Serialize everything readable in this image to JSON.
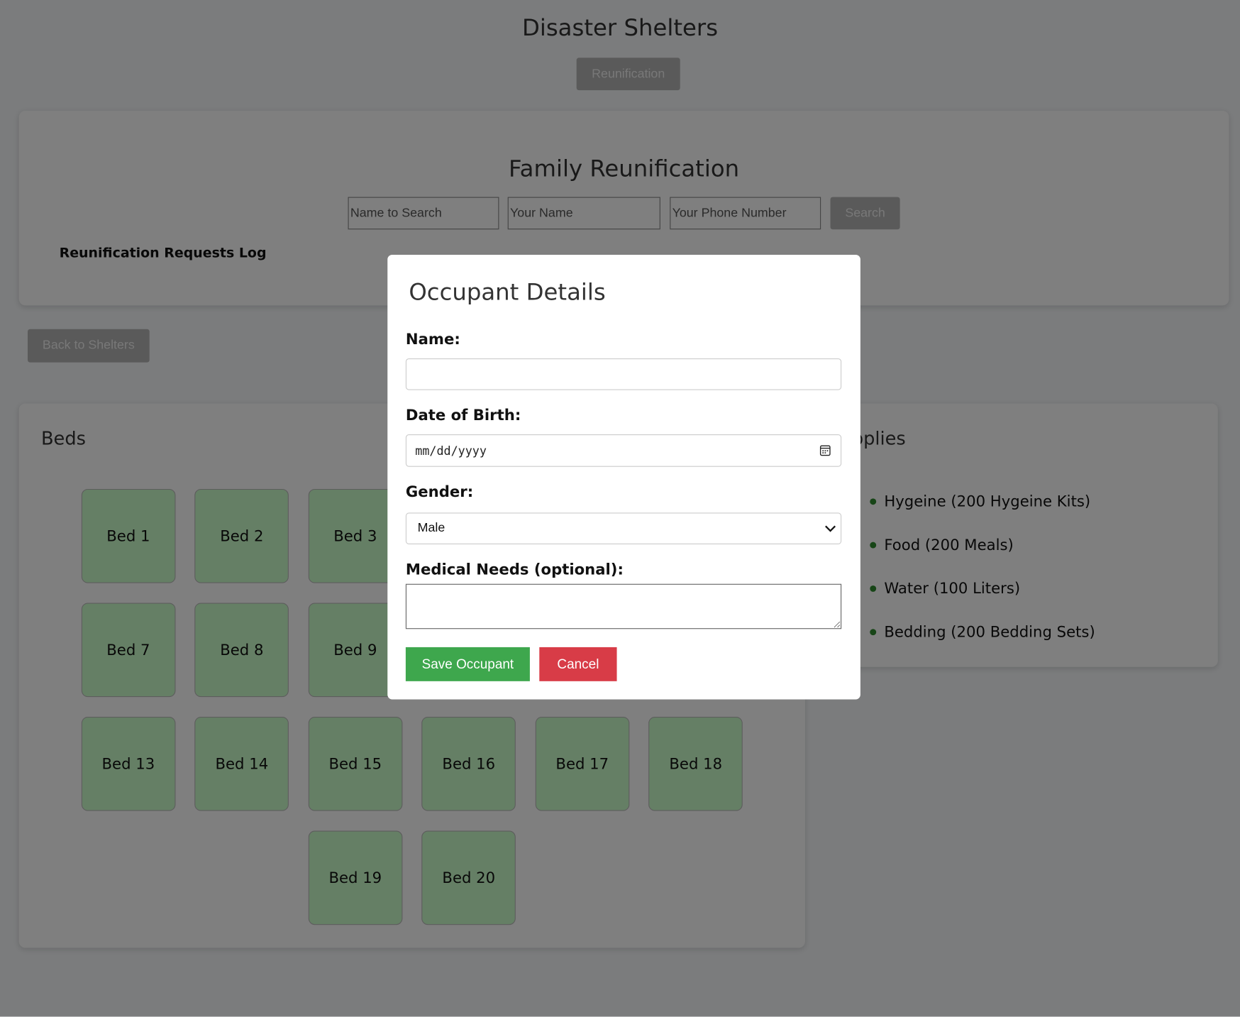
{
  "header": {
    "title": "Disaster Shelters",
    "reunification_button": "Reunification"
  },
  "reunification": {
    "title": "Family Reunification",
    "name_to_search_placeholder": "Name to Search",
    "your_name_placeholder": "Your Name",
    "phone_placeholder": "Your Phone Number",
    "search_button": "Search",
    "log_title": "Reunification Requests Log"
  },
  "back_button": "Back to Shelters",
  "beds": {
    "title": "Beds",
    "items": [
      "Bed 1",
      "Bed 2",
      "Bed 3",
      "",
      "",
      "",
      "Bed 7",
      "Bed 8",
      "Bed 9",
      "",
      "",
      "",
      "Bed 13",
      "Bed 14",
      "Bed 15",
      "Bed 16",
      "Bed 17",
      "Bed 18",
      "Bed 19",
      "Bed 20"
    ]
  },
  "supplies": {
    "title": "Supplies",
    "items": [
      "Hygeine (200 Hygeine Kits)",
      "Food (200 Meals)",
      "Water (100 Liters)",
      "Bedding (200 Bedding Sets)"
    ]
  },
  "modal": {
    "title": "Occupant Details",
    "name_label": "Name:",
    "name_value": "",
    "dob_label": "Date of Birth:",
    "dob_placeholder": "mm/dd/yyyy",
    "gender_label": "Gender:",
    "gender_value": "Male",
    "medical_label": "Medical Needs (optional):",
    "medical_value": "",
    "save_button": "Save Occupant",
    "cancel_button": "Cancel"
  },
  "colors": {
    "save": "#3ea74d",
    "cancel": "#d83c47",
    "bed": "#cbffcb",
    "bullet": "#2e8b2e"
  }
}
